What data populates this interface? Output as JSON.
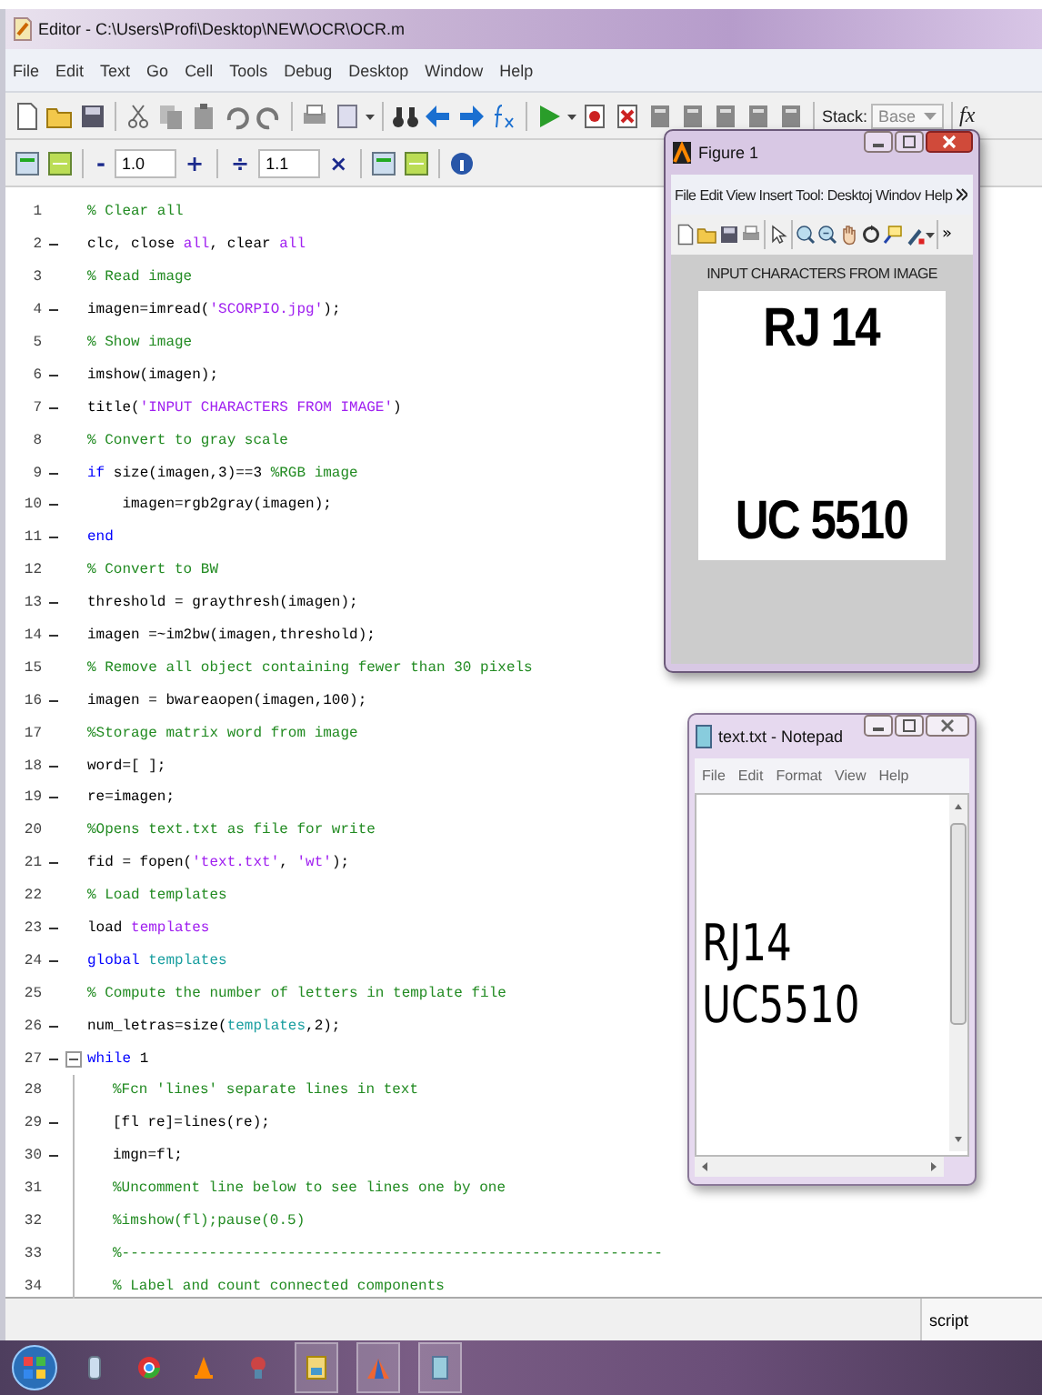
{
  "editor": {
    "title": "Editor - C:\\Users\\Profi\\Desktop\\NEW\\OCR\\OCR.m",
    "menu": [
      "File",
      "Edit",
      "Text",
      "Go",
      "Cell",
      "Tools",
      "Debug",
      "Desktop",
      "Window",
      "Help"
    ],
    "toolbar": {
      "stack_label": "Stack:",
      "stack_value": "Base",
      "fx": "fx"
    },
    "cell_toolbar": {
      "minus": "-",
      "decrement": "1.0",
      "plus": "+",
      "divide": "÷",
      "increment": "1.1",
      "times": "×"
    },
    "lines": [
      {
        "number": "1",
        "exec": false,
        "segments": [
          {
            "kind": "comment",
            "text": "% Clear all"
          }
        ]
      },
      {
        "number": "2",
        "exec": true,
        "segments": [
          {
            "kind": "plain",
            "text": "clc, close "
          },
          {
            "kind": "string",
            "text": "all"
          },
          {
            "kind": "plain",
            "text": ", clear "
          },
          {
            "kind": "string",
            "text": "all"
          }
        ]
      },
      {
        "number": "3",
        "exec": false,
        "segments": [
          {
            "kind": "comment",
            "text": "% Read image"
          }
        ]
      },
      {
        "number": "4",
        "exec": true,
        "segments": [
          {
            "kind": "plain",
            "text": "imagen=imread("
          },
          {
            "kind": "string",
            "text": "'SCORPIO.jpg'"
          },
          {
            "kind": "plain",
            "text": ");"
          }
        ]
      },
      {
        "number": "5",
        "exec": false,
        "segments": [
          {
            "kind": "comment",
            "text": "% Show image"
          }
        ]
      },
      {
        "number": "6",
        "exec": true,
        "segments": [
          {
            "kind": "plain",
            "text": "imshow(imagen);"
          }
        ]
      },
      {
        "number": "7",
        "exec": true,
        "segments": [
          {
            "kind": "plain",
            "text": "title("
          },
          {
            "kind": "string",
            "text": "'INPUT CHARACTERS FROM IMAGE'"
          },
          {
            "kind": "plain",
            "text": ")"
          }
        ]
      },
      {
        "number": "8",
        "exec": false,
        "segments": [
          {
            "kind": "comment",
            "text": "% Convert to gray scale"
          }
        ]
      },
      {
        "number": "9",
        "exec": true,
        "segments": [
          {
            "kind": "keyword",
            "text": "if"
          },
          {
            "kind": "plain",
            "text": " size(imagen,3)==3 "
          },
          {
            "kind": "comment",
            "text": "%RGB image"
          }
        ]
      },
      {
        "number": "10",
        "exec": true,
        "segments": [
          {
            "kind": "plain",
            "text": "    imagen=rgb2gray(imagen);"
          }
        ]
      },
      {
        "number": "11",
        "exec": true,
        "segments": [
          {
            "kind": "keyword",
            "text": "end"
          }
        ]
      },
      {
        "number": "12",
        "exec": false,
        "segments": [
          {
            "kind": "comment",
            "text": "% Convert to BW"
          }
        ]
      },
      {
        "number": "13",
        "exec": true,
        "segments": [
          {
            "kind": "plain",
            "text": "threshold = graythresh(imagen);"
          }
        ]
      },
      {
        "number": "14",
        "exec": true,
        "segments": [
          {
            "kind": "plain",
            "text": "imagen =~im2bw(imagen,threshold);"
          }
        ]
      },
      {
        "number": "15",
        "exec": false,
        "segments": [
          {
            "kind": "comment",
            "text": "% Remove all object containing fewer than 30 pixels"
          }
        ]
      },
      {
        "number": "16",
        "exec": true,
        "segments": [
          {
            "kind": "plain",
            "text": "imagen = bwareaopen(imagen,100);"
          }
        ]
      },
      {
        "number": "17",
        "exec": false,
        "segments": [
          {
            "kind": "comment",
            "text": "%Storage matrix word from image"
          }
        ]
      },
      {
        "number": "18",
        "exec": true,
        "segments": [
          {
            "kind": "plain",
            "text": "word=[ ];"
          }
        ]
      },
      {
        "number": "19",
        "exec": true,
        "segments": [
          {
            "kind": "plain",
            "text": "re=imagen;"
          }
        ]
      },
      {
        "number": "20",
        "exec": false,
        "segments": [
          {
            "kind": "comment",
            "text": "%Opens text.txt as file for write"
          }
        ]
      },
      {
        "number": "21",
        "exec": true,
        "segments": [
          {
            "kind": "plain",
            "text": "fid = fopen("
          },
          {
            "kind": "string",
            "text": "'text.txt'"
          },
          {
            "kind": "plain",
            "text": ", "
          },
          {
            "kind": "string",
            "text": "'wt'"
          },
          {
            "kind": "plain",
            "text": ");"
          }
        ]
      },
      {
        "number": "22",
        "exec": false,
        "segments": [
          {
            "kind": "comment",
            "text": "% Load templates"
          }
        ]
      },
      {
        "number": "23",
        "exec": true,
        "segments": [
          {
            "kind": "plain",
            "text": "load "
          },
          {
            "kind": "string",
            "text": "templates"
          }
        ]
      },
      {
        "number": "24",
        "exec": true,
        "segments": [
          {
            "kind": "keyword",
            "text": "global"
          },
          {
            "kind": "global",
            "text": " templates"
          }
        ]
      },
      {
        "number": "25",
        "exec": false,
        "segments": [
          {
            "kind": "comment",
            "text": "% Compute the number of letters in template file"
          }
        ]
      },
      {
        "number": "26",
        "exec": true,
        "segments": [
          {
            "kind": "plain",
            "text": "num_letras=size("
          },
          {
            "kind": "global",
            "text": "templates"
          },
          {
            "kind": "plain",
            "text": ",2);"
          }
        ]
      },
      {
        "number": "27",
        "exec": true,
        "expanded": true,
        "segments": [
          {
            "kind": "keyword",
            "text": "while"
          },
          {
            "kind": "plain",
            "text": " 1"
          }
        ],
        "children": [
          {
            "number": "28",
            "exec": false,
            "segments": [
              {
                "kind": "comment",
                "text": "%Fcn 'lines' separate lines in text"
              }
            ]
          },
          {
            "number": "29",
            "exec": true,
            "segments": [
              {
                "kind": "plain",
                "text": "[fl re]=lines(re);"
              }
            ]
          },
          {
            "number": "30",
            "exec": true,
            "segments": [
              {
                "kind": "plain",
                "text": "imgn=fl;"
              }
            ]
          },
          {
            "number": "31",
            "exec": false,
            "segments": [
              {
                "kind": "comment",
                "text": "%Uncomment line below to see lines one by one"
              }
            ]
          },
          {
            "number": "32",
            "exec": false,
            "segments": [
              {
                "kind": "comment",
                "text": "%imshow(fl);pause(0.5)"
              }
            ]
          },
          {
            "number": "33",
            "exec": false,
            "segments": [
              {
                "kind": "comment",
                "text": "%--------------------------------------------------------------"
              }
            ]
          },
          {
            "number": "34",
            "exec": false,
            "segments": [
              {
                "kind": "comment",
                "text": "% Label and count connected components"
              }
            ]
          }
        ]
      }
    ],
    "status_bar": {
      "mode": "script"
    }
  },
  "figure": {
    "title": "Figure 1",
    "menu": [
      "File",
      "Edit",
      "View",
      "Insert",
      "Tool:",
      "Desktoj",
      "Windov",
      "Help"
    ],
    "more": "»",
    "axes_title": "INPUT CHARACTERS FROM IMAGE",
    "image_lines": [
      "RJ 14",
      "UC 5510"
    ]
  },
  "notepad": {
    "title": "text.txt - Notepad",
    "menu": [
      "File",
      "Edit",
      "Format",
      "View",
      "Help"
    ],
    "content": [
      "RJ14",
      "UC5510"
    ]
  }
}
